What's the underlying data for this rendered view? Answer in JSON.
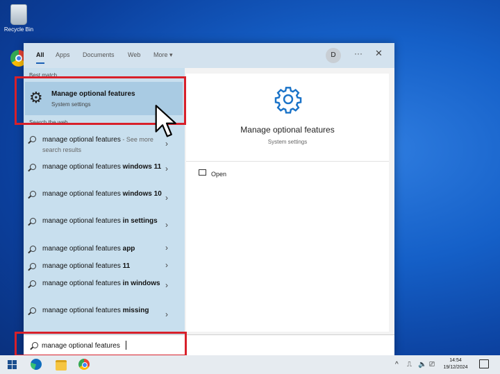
{
  "desktop": {
    "recycle_bin_label": "Recycle Bin",
    "chrome_label": "Google Chrome"
  },
  "search": {
    "tabs": [
      {
        "label": "All"
      },
      {
        "label": "Apps"
      },
      {
        "label": "Documents"
      },
      {
        "label": "Web"
      },
      {
        "label": "More ▾"
      }
    ],
    "avatar_initial": "D",
    "more_options_icon": "ellipsis-icon",
    "close_icon": "close-icon",
    "best_match_label": "Best match",
    "best_match": {
      "title": "Manage optional features",
      "subtitle": "System settings",
      "icon": "gear-icon"
    },
    "search_web_label": "Search the web",
    "web_results": [
      {
        "text": "manage optional features",
        "bold": "",
        "suffix": " - See more search results"
      },
      {
        "text": "manage optional features ",
        "bold": "windows 11",
        "suffix": ""
      },
      {
        "text": "manage optional features ",
        "bold": "windows 10",
        "suffix": ""
      },
      {
        "text": "manage optional features ",
        "bold": "in settings",
        "suffix": ""
      },
      {
        "text": "manage optional features ",
        "bold": "app",
        "suffix": ""
      },
      {
        "text": "manage optional features ",
        "bold": "11",
        "suffix": ""
      },
      {
        "text": "manage optional features ",
        "bold": "in windows",
        "suffix": ""
      },
      {
        "text": "manage optional features ",
        "bold": "missing",
        "suffix": ""
      }
    ],
    "detail": {
      "title": "Manage optional features",
      "subtitle": "System settings",
      "action_open": "Open"
    },
    "query": "manage optional features"
  },
  "taskbar": {
    "time": "14:54",
    "date": "19/12/2024"
  }
}
